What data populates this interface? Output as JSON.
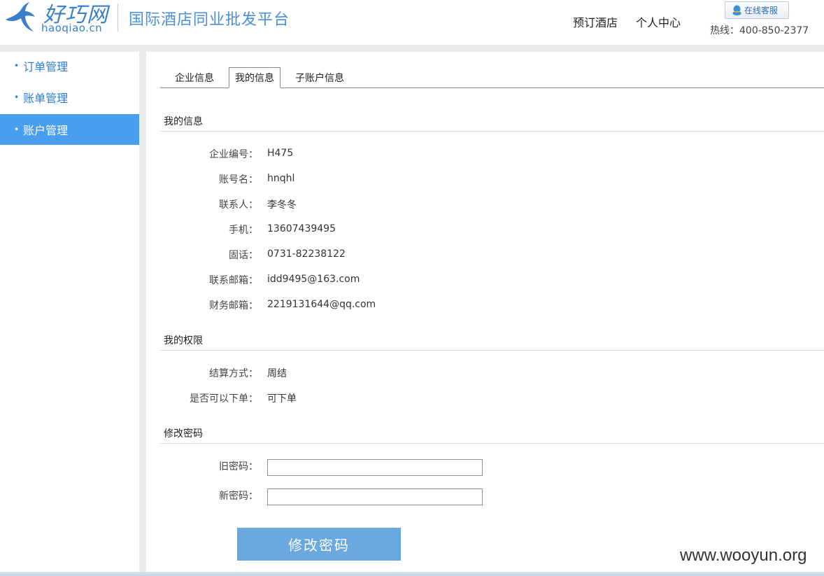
{
  "header": {
    "logo_cn": "好巧网",
    "logo_en": "haoqiao.cn",
    "tagline": "国际酒店同业批发平台",
    "nav": [
      "预订酒店",
      "个人中心"
    ],
    "service_button": "在线客服",
    "service_icon": "qq-penguin-icon",
    "hotline": "热线：400-850-2377"
  },
  "sidebar": {
    "items": [
      {
        "label": "订单管理",
        "active": false
      },
      {
        "label": "账单管理",
        "active": false
      },
      {
        "label": "账户管理",
        "active": true
      }
    ],
    "active_color": "#4a9ef0",
    "link_color": "#2a7fd6"
  },
  "tabs": [
    {
      "label": "企业信息",
      "active": false
    },
    {
      "label": "我的信息",
      "active": true
    },
    {
      "label": "子账户信息",
      "active": false
    }
  ],
  "my_info": {
    "title": "我的信息",
    "fields": [
      {
        "label": "企业编号：",
        "value": "H475"
      },
      {
        "label": "账号名：",
        "value": "hnqhl"
      },
      {
        "label": "联系人：",
        "value": "李冬冬"
      },
      {
        "label": "手机：",
        "value": "13607439495"
      },
      {
        "label": "固话：",
        "value": "0731-82238122"
      },
      {
        "label": "联系邮箱：",
        "value": "idd9495@163.com"
      },
      {
        "label": "财务邮箱：",
        "value": "2219131644@qq.com"
      }
    ]
  },
  "permissions": {
    "title": "我的权限",
    "fields": [
      {
        "label": "结算方式：",
        "value": "周结"
      },
      {
        "label": "是否可以下单：",
        "value": "可下单"
      }
    ]
  },
  "change_password": {
    "title": "修改密码",
    "old_label": "旧密码：",
    "old_value": "",
    "new_label": "新密码：",
    "new_value": "",
    "submit_label": "修改密码",
    "button_color": "#6aa8e0"
  },
  "watermark": "www.wooyun.org"
}
